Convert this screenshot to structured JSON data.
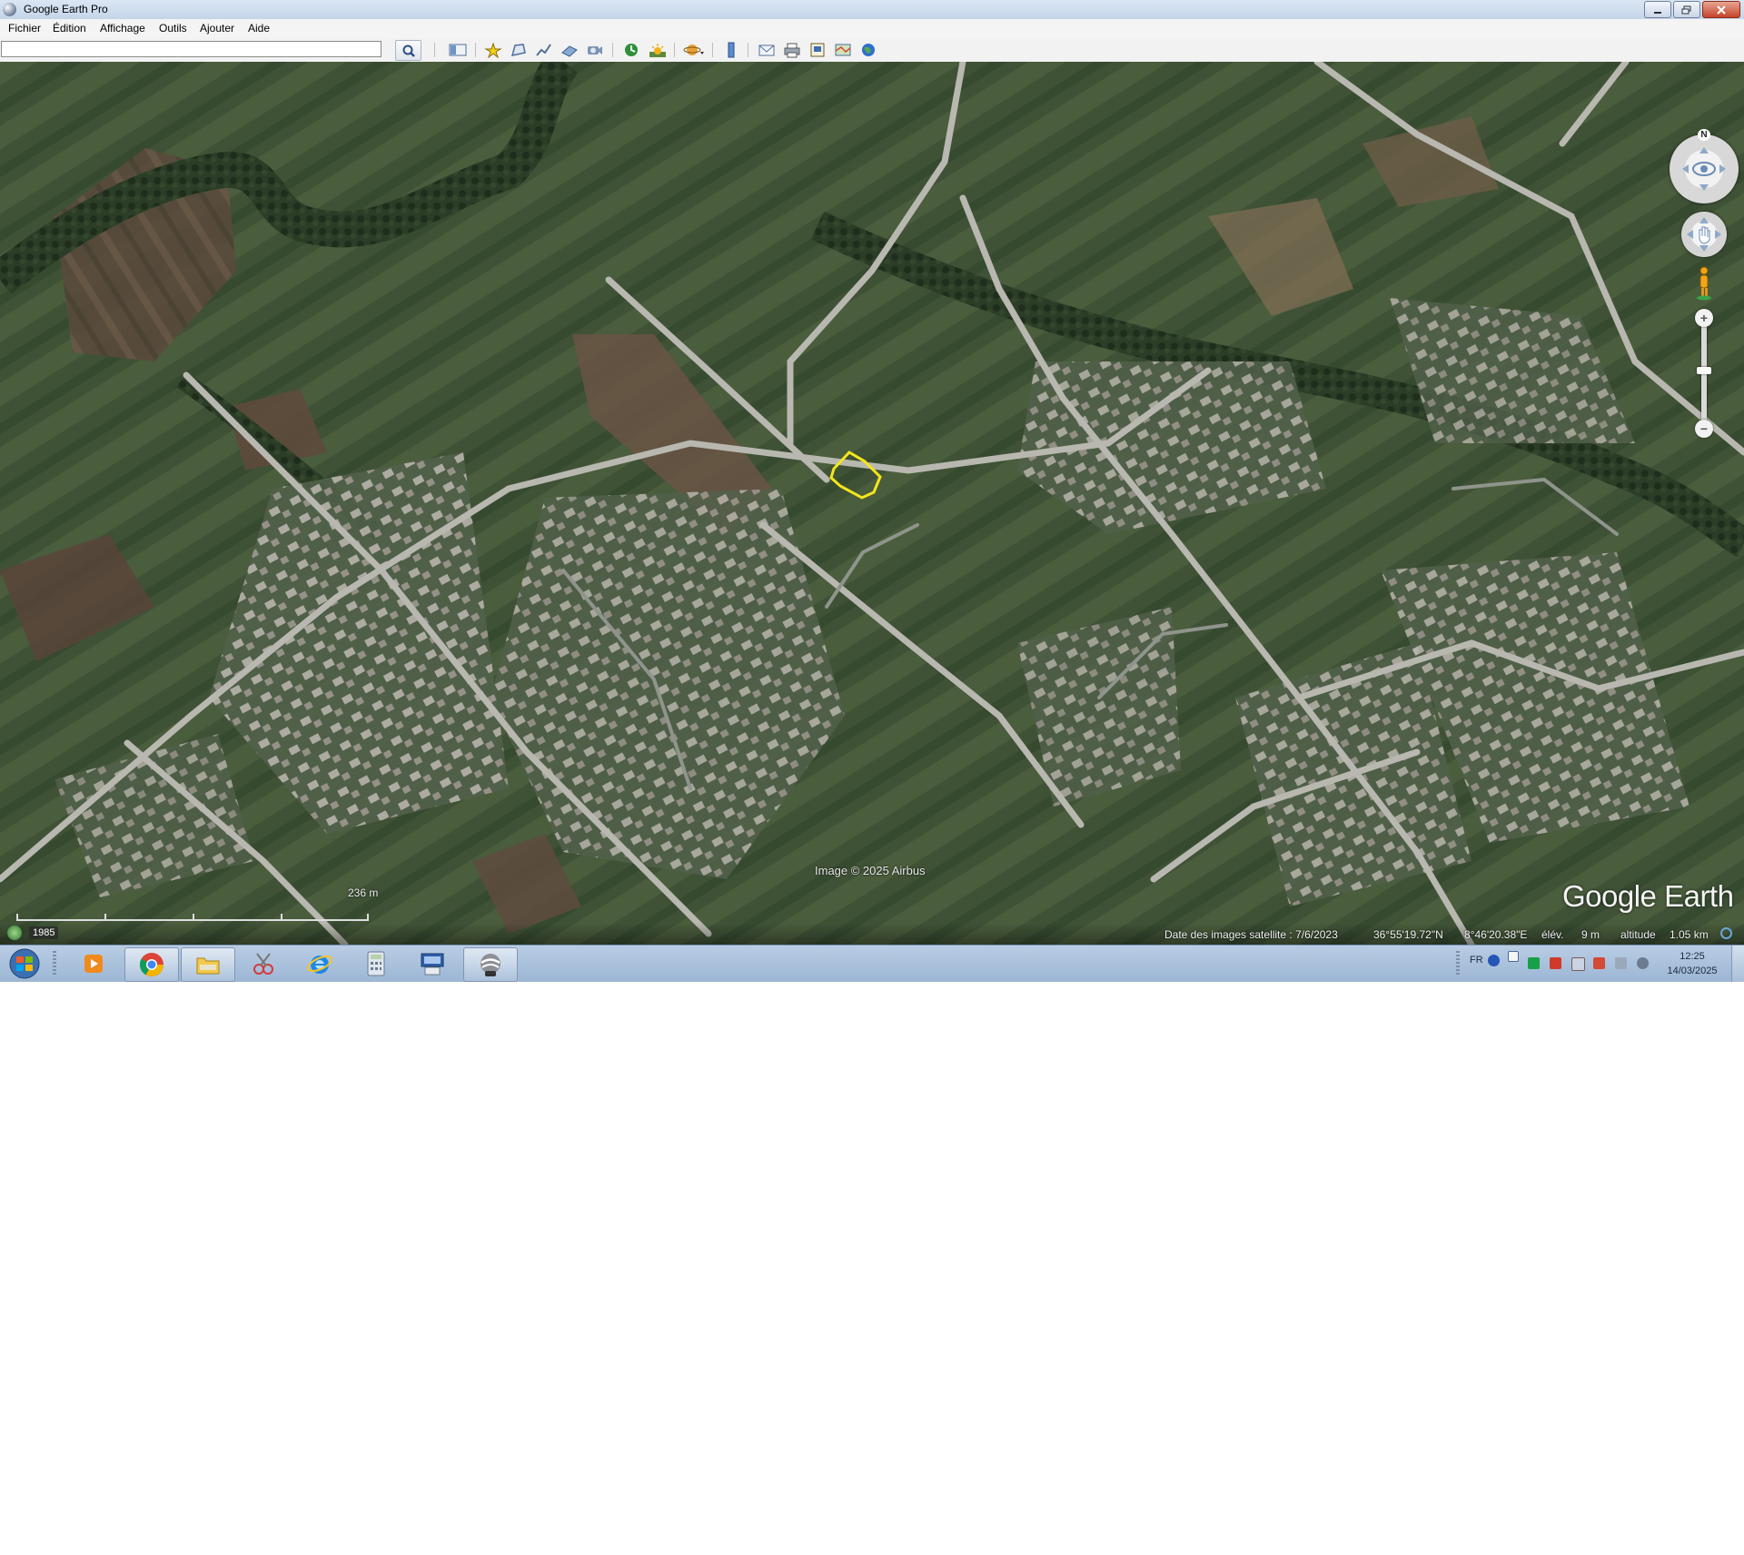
{
  "window": {
    "title": "Google Earth Pro"
  },
  "menu": [
    {
      "label": "Fichier"
    },
    {
      "label": "Édition"
    },
    {
      "label": "Affichage"
    },
    {
      "label": "Outils"
    },
    {
      "label": "Ajouter"
    },
    {
      "label": "Aide"
    }
  ],
  "search": {
    "value": "",
    "placeholder": ""
  },
  "map": {
    "attribution": "Image © 2025 Airbus",
    "logo": "Google Earth",
    "scale_label": "236  m",
    "historical_year": "1985",
    "compass_north": "N",
    "polygon_color": "#f5e61b"
  },
  "status": {
    "imagery_date": "Date des images satellite : 7/6/2023",
    "latitude": "36°55'19.72\"N",
    "longitude": "8°46'20.38\"E",
    "elevation_label": "élév.",
    "elevation_value": "9 m",
    "altitude_label": "altitude",
    "altitude_value": "1.05 km"
  },
  "taskbar": {
    "language": "FR",
    "time": "12:25",
    "date": "14/03/2025",
    "apps": [
      "media-player-icon",
      "chrome-icon",
      "file-explorer-icon",
      "snipping-tool-icon",
      "internet-explorer-icon",
      "calculator-icon",
      "network-printer-icon",
      "google-earth-pro-icon"
    ],
    "active_app": "google-earth-pro-icon"
  }
}
